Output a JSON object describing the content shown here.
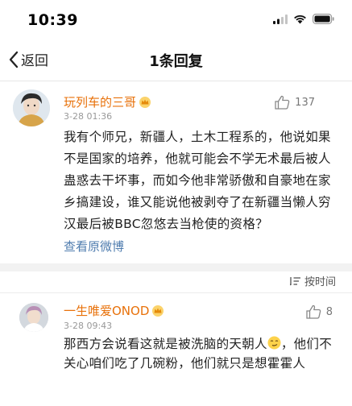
{
  "status_bar": {
    "time": "10:39"
  },
  "nav": {
    "back_label": "返回",
    "title": "1条回复"
  },
  "post": {
    "username": "玩列车的三哥",
    "date": "3-28 01:36",
    "likes": "137",
    "body": "我有个师兄，新疆人，土木工程系的，他说如果不是国家的培养，他就可能会不学无术最后被人蛊惑去干坏事，而如今他非常骄傲和自豪地在家乡搞建设，谁又能说他被剥夺了在新疆当懒人穷汉最后被BBC忽悠去当枪使的资格？",
    "view_original": "查看原微博"
  },
  "sort": {
    "label": "按时间"
  },
  "reply": {
    "username": "一生唯爱ONOD",
    "date": "3-28 09:43",
    "likes": "8",
    "body_part1": "那西方会说看这就是被洗脑的天朝人",
    "body_part2": "，他们不关心咱们吃了几碗粉，他们就只是想霍霍人"
  },
  "colors": {
    "username": "#e8710a",
    "link": "#507daf",
    "meta": "#999999",
    "background": "#f2f2f2"
  },
  "icons": [
    "signal-icon",
    "wifi-icon",
    "battery-icon",
    "back-chevron-icon",
    "crown-badge-icon",
    "thumbs-up-icon",
    "sort-icon",
    "smirk-emoji-icon"
  ]
}
